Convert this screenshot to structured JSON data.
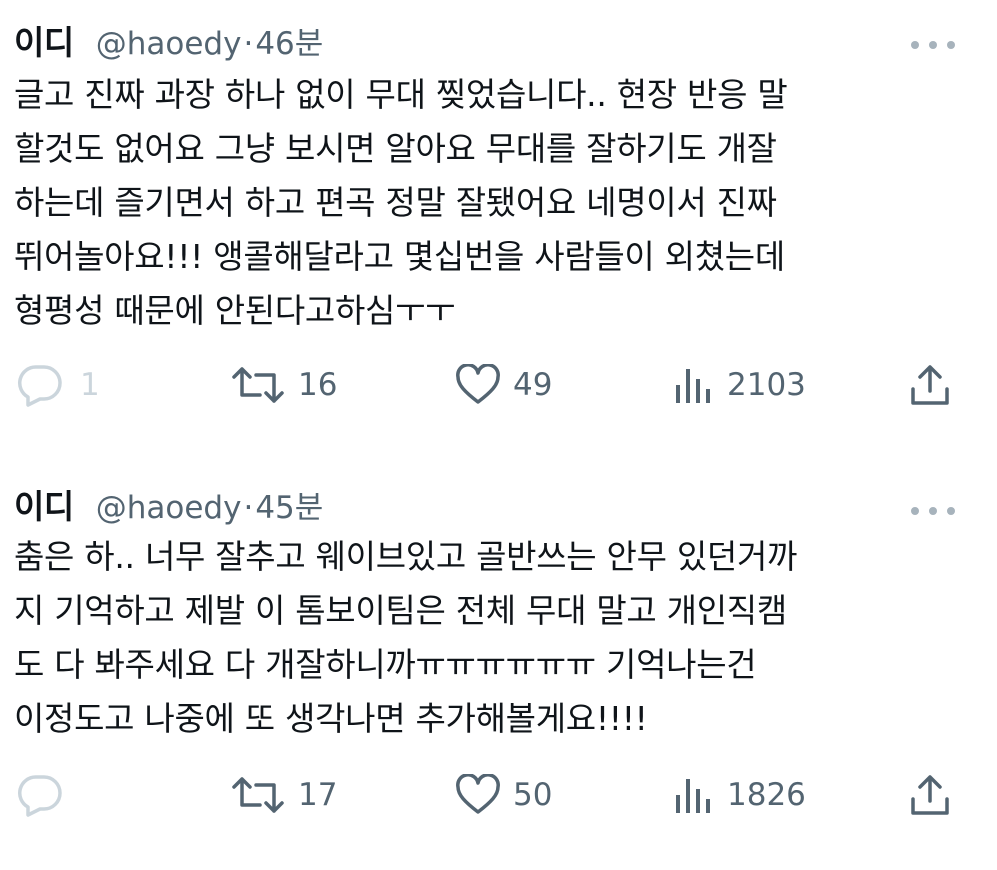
{
  "tweets": [
    {
      "name": "이디",
      "handle": "@haoedy",
      "separator": "·",
      "time": "46분",
      "text": "글고 진짜 과장 하나 없이 무대 찢었습니다.. 현장 반응 말\n할것도 없어요 그냥 보시면 알아요 무대를 잘하기도 개잘\n하는데 즐기면서 하고 편곡 정말 잘됐어요 네명이서 진짜\n뛰어놀아요!!! 앵콜해달라고 몇십번을 사람들이 외쳤는데\n형평성 때문에 안된다고하심ㅜㅜ",
      "replies": "1",
      "retweets": "16",
      "likes": "49",
      "views": "2103",
      "icons": {
        "reply": "reply-icon",
        "retweet": "retweet-icon",
        "like": "heart-icon",
        "views": "views-icon",
        "share": "share-icon",
        "more": "more-icon"
      }
    },
    {
      "name": "이디",
      "handle": "@haoedy",
      "separator": "·",
      "time": "45분",
      "text": "춤은 하.. 너무 잘추고 웨이브있고 골반쓰는 안무 있던거까\n지 기억하고 제발 이 톰보이팀은 전체 무대 말고 개인직캠\n도 다 봐주세요 다 개잘하니까ㅠㅠㅠㅠㅠㅠ 기억나는건\n이정도고 나중에 또 생각나면 추가해볼게요!!!!",
      "replies": "",
      "retweets": "17",
      "likes": "50",
      "views": "1826",
      "icons": {
        "reply": "reply-icon",
        "retweet": "retweet-icon",
        "like": "heart-icon",
        "views": "views-icon",
        "share": "share-icon",
        "more": "more-icon"
      }
    }
  ],
  "colors": {
    "text": "#0f1419",
    "secondary": "#536471",
    "faint": "#cbd5dc",
    "background": "#ffffff"
  }
}
